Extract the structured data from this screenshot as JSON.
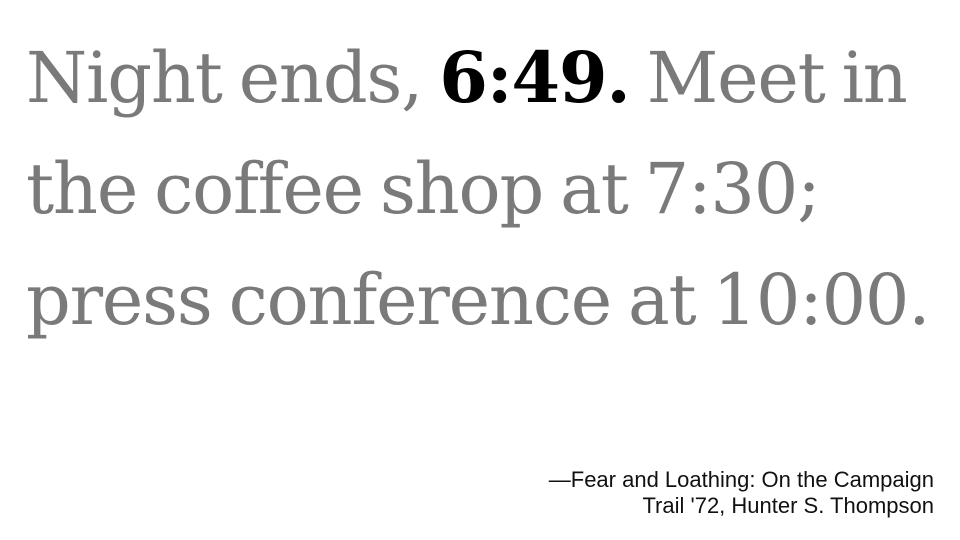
{
  "quote": {
    "before_time": "Night ends, ",
    "time": "6:49.",
    "after_time": " Meet in the coffee shop at 7:30; press conference at 10:00."
  },
  "attribution": {
    "line1": "—Fear and Loathing: On the Campaign",
    "line2": "Trail '72, Hunter S. Thompson"
  },
  "colors": {
    "quote_text": "#7a7a7a",
    "highlight_text": "#000000",
    "attribution_text": "#111111",
    "background": "#ffffff"
  }
}
